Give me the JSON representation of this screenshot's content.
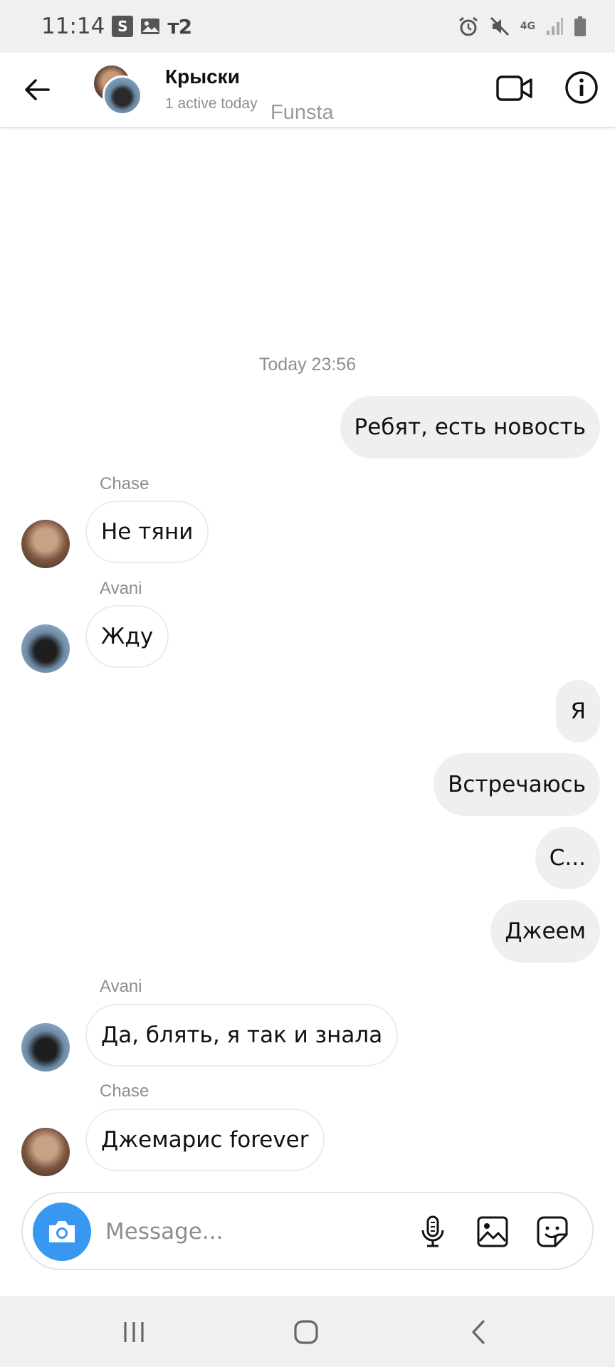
{
  "status_bar": {
    "time": "11:14",
    "s_badge": "S",
    "carrier": "т2",
    "network": "4G",
    "icons": [
      "alarm-icon",
      "mute-icon",
      "signal-icon",
      "battery-icon",
      "gallery-icon"
    ]
  },
  "header": {
    "title": "Крыски",
    "subtitle": "1 active today",
    "watermark": "Funsta"
  },
  "conversation": {
    "timestamp": "Today 23:56",
    "messages": [
      {
        "direction": "out",
        "text": "Ребят, есть новость"
      },
      {
        "direction": "in",
        "sender": "Chase",
        "text": "Не тяни"
      },
      {
        "direction": "in",
        "sender": "Avani",
        "text": "Жду"
      },
      {
        "direction": "out",
        "text": "Я"
      },
      {
        "direction": "out",
        "text": "Встречаюсь"
      },
      {
        "direction": "out",
        "text": "С..."
      },
      {
        "direction": "out",
        "text": "Джеем"
      },
      {
        "direction": "in",
        "sender": "Avani",
        "text": "Да, блять, я так и знала"
      },
      {
        "direction": "in",
        "sender": "Chase",
        "text": "Джемарис forever"
      }
    ]
  },
  "composer": {
    "placeholder": "Message..."
  },
  "colors": {
    "accent": "#3897f0",
    "outgoing_bubble": "#efeff1",
    "secondary_text": "#8e8e8e",
    "system_bar": "#f0f0f2"
  }
}
